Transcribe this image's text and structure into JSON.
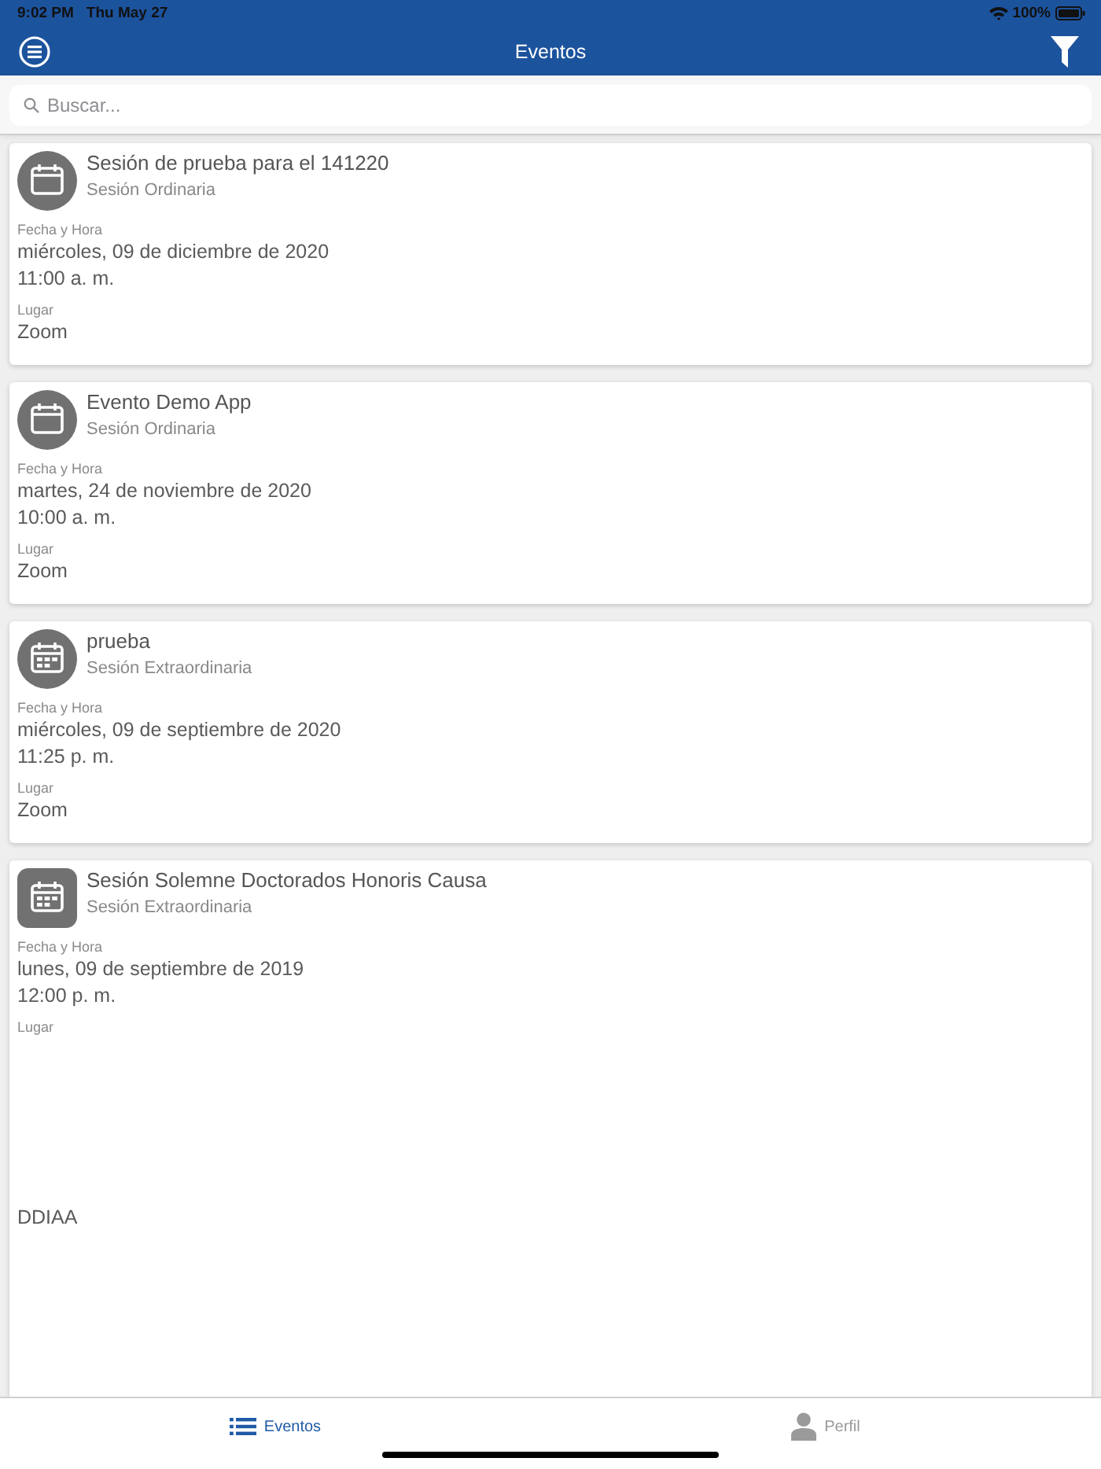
{
  "status_bar": {
    "time": "9:02 PM",
    "date": "Thu May 27",
    "battery": "100%"
  },
  "nav_bar": {
    "title": "Eventos"
  },
  "search": {
    "placeholder": "Buscar..."
  },
  "events": [
    {
      "kind": "plain",
      "title": "Sesión de prueba para el 141220",
      "type": "Sesión Ordinaria",
      "date_label": "Fecha y Hora",
      "date": "miércoles, 09 de diciembre de 2020",
      "time": "11:00 a. m.",
      "place_label": "Lugar",
      "place": "Zoom"
    },
    {
      "kind": "plain",
      "title": "Evento Demo App",
      "type": "Sesión Ordinaria",
      "date_label": "Fecha y Hora",
      "date": "martes, 24 de noviembre de 2020",
      "time": "10:00 a. m.",
      "place_label": "Lugar",
      "place": "Zoom"
    },
    {
      "kind": "grid",
      "title": "prueba",
      "type": "Sesión Extraordinaria",
      "date_label": "Fecha y Hora",
      "date": "miércoles, 09 de septiembre de 2020",
      "time": "11:25 p. m.",
      "place_label": "Lugar",
      "place": "Zoom"
    },
    {
      "kind": "tile",
      "title": "Sesión Solemne Doctorados Honoris Causa",
      "type": "Sesión Extraordinaria",
      "date_label": "Fecha y Hora",
      "date": "lunes, 09 de septiembre de 2019",
      "time": "12:00 p. m.",
      "place_label": "Lugar",
      "place": "DDIAA"
    }
  ],
  "tab_bar": [
    {
      "kind": "list",
      "label": "Eventos",
      "selected": true
    },
    {
      "kind": "person",
      "label": "Perfil",
      "selected": false
    }
  ]
}
